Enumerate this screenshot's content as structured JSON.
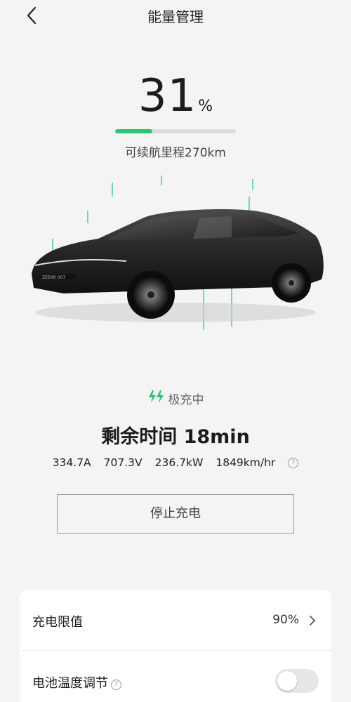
{
  "header": {
    "title": "能量管理",
    "back_icon": "back-arrow-icon"
  },
  "battery": {
    "percent": "31",
    "unit": "%",
    "fill_fraction": 0.31,
    "range_label": "可续航里程270km",
    "fill_color": "#2ec273"
  },
  "car": {
    "badge_text": "ZEEKR 007"
  },
  "charging": {
    "status_icon": "fast-charge-bolt-icon",
    "status_label": "极充中",
    "remaining": "剩余时间 18min",
    "stats": [
      "334.7A",
      "707.3V",
      "236.7kW",
      "1849km/hr"
    ],
    "help_icon": "help-circle-icon",
    "stop_button": "停止充电"
  },
  "settings": {
    "items": [
      {
        "label": "充电限值",
        "value": "90%",
        "icon": "chevron-right-icon"
      },
      {
        "label": "电池温度调节",
        "toggle_on": false,
        "help_icon": "help-circle-icon"
      }
    ]
  },
  "colors": {
    "accent": "#2ec273",
    "background": "#f4f4f4",
    "card": "#ffffff"
  }
}
